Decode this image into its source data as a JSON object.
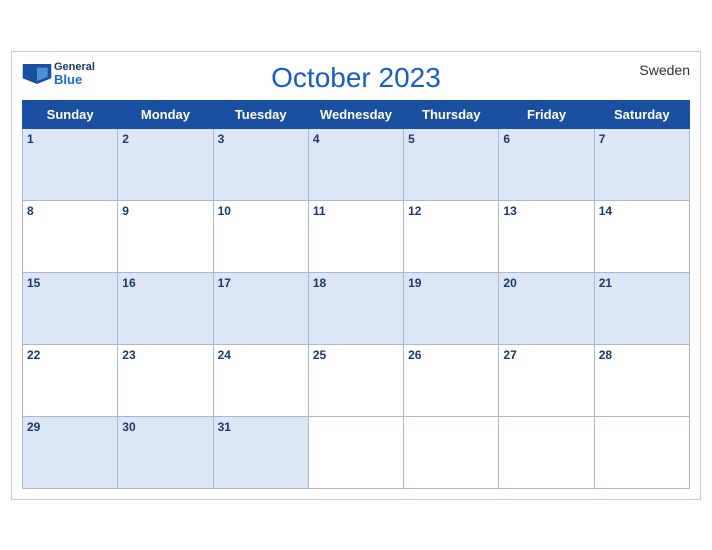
{
  "header": {
    "title": "October 2023",
    "country": "Sweden",
    "logo_general": "General",
    "logo_blue": "Blue"
  },
  "weekdays": [
    "Sunday",
    "Monday",
    "Tuesday",
    "Wednesday",
    "Thursday",
    "Friday",
    "Saturday"
  ],
  "weeks": [
    [
      1,
      2,
      3,
      4,
      5,
      6,
      7
    ],
    [
      8,
      9,
      10,
      11,
      12,
      13,
      14
    ],
    [
      15,
      16,
      17,
      18,
      19,
      20,
      21
    ],
    [
      22,
      23,
      24,
      25,
      26,
      27,
      28
    ],
    [
      29,
      30,
      31,
      null,
      null,
      null,
      null
    ]
  ]
}
